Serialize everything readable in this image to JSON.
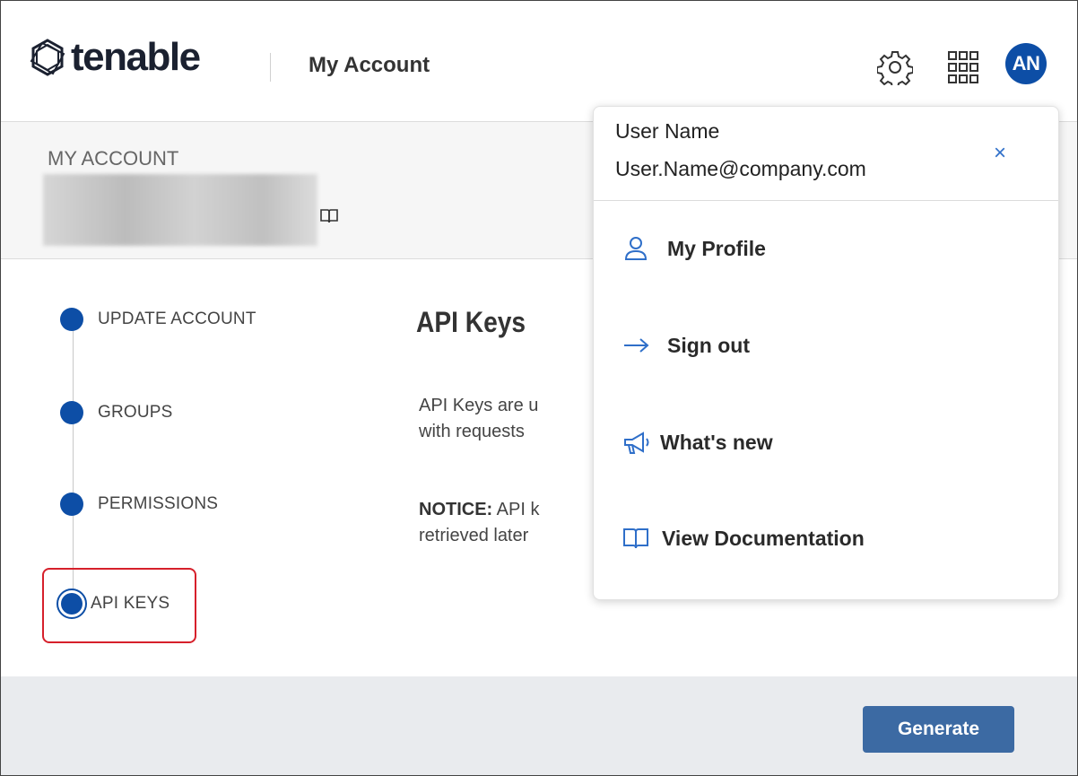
{
  "header": {
    "logo_text": "tenable",
    "app_title": "My Account",
    "avatar_initials": "AN",
    "icons": [
      "settings-gear-icon",
      "app-grid-icon"
    ]
  },
  "account": {
    "label": "MY ACCOUNT"
  },
  "steps": [
    {
      "label": "UPDATE ACCOUNT"
    },
    {
      "label": "GROUPS"
    },
    {
      "label": "PERMISSIONS"
    },
    {
      "label": "API KEYS",
      "active": true
    }
  ],
  "main": {
    "title": "API Keys",
    "para1_line1": "API Keys are u",
    "para1_line2": "with requests",
    "notice_label": "NOTICE:",
    "notice_line1": " API k",
    "notice_line2": "retrieved later"
  },
  "footer": {
    "generate_label": "Generate"
  },
  "user_menu": {
    "user_name": "User Name",
    "user_email": "User.Name@company.com",
    "close_glyph": "×",
    "items": [
      {
        "label": "My Profile",
        "icon": "user-icon"
      },
      {
        "label": "Sign out",
        "icon": "arrow-right-icon"
      },
      {
        "label": "What's new",
        "icon": "megaphone-icon"
      },
      {
        "label": "View Documentation",
        "icon": "book-icon"
      }
    ]
  },
  "colors": {
    "brand_blue": "#0d4ea6",
    "button_blue": "#3c6aa3",
    "highlight_red": "#d6202b"
  }
}
